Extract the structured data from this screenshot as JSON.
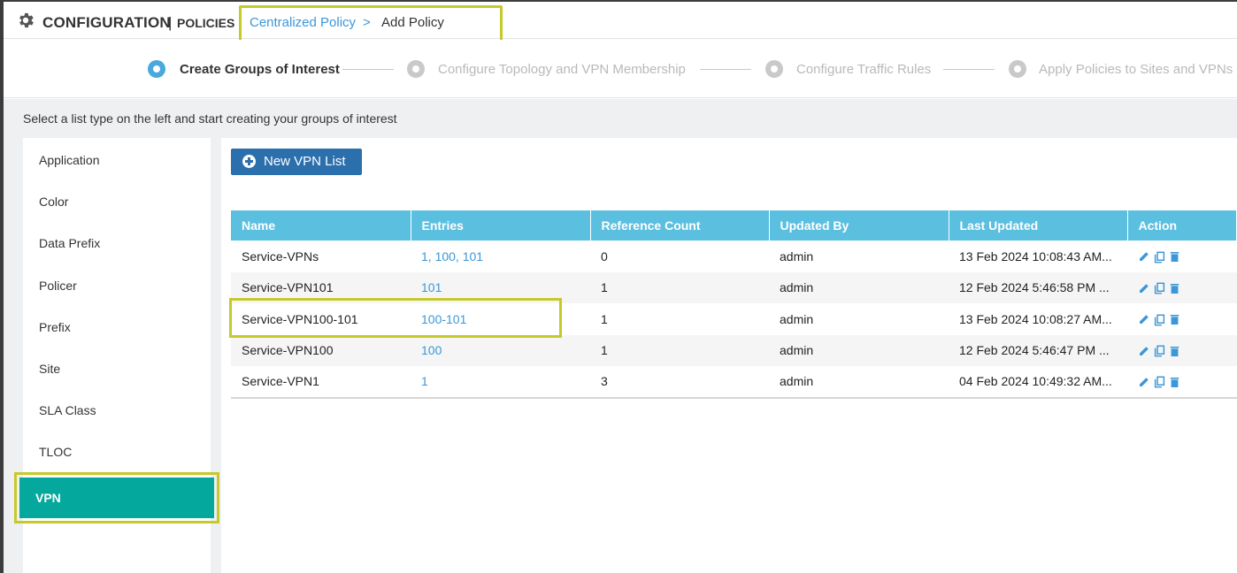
{
  "header": {
    "title": "CONFIGURATION",
    "separator": "|",
    "subtitle": "POLICIES",
    "breadcrumb_link": "Centralized Policy",
    "breadcrumb_arrow": ">",
    "breadcrumb_current": "Add Policy"
  },
  "steps": [
    {
      "label": "Create Groups of Interest",
      "state": "active"
    },
    {
      "label": "Configure Topology and VPN Membership",
      "state": "inactive"
    },
    {
      "label": "Configure Traffic Rules",
      "state": "inactive"
    },
    {
      "label": "Apply Policies to Sites and VPNs",
      "state": "inactive"
    }
  ],
  "instructions": "Select a list type on the left and start creating your groups of interest",
  "sidebar": {
    "items": [
      "Application",
      "Color",
      "Data Prefix",
      "Policer",
      "Prefix",
      "Site",
      "SLA Class",
      "TLOC"
    ],
    "active": "VPN"
  },
  "main": {
    "new_button": "New VPN List",
    "table": {
      "headers": [
        "Name",
        "Entries",
        "Reference Count",
        "Updated By",
        "Last Updated",
        "Action"
      ],
      "rows": [
        {
          "name": "Service-VPNs",
          "entries": "1, 100, 101",
          "ref": "0",
          "by": "admin",
          "updated": "13 Feb 2024 10:08:43 AM..."
        },
        {
          "name": "Service-VPN101",
          "entries": "101",
          "ref": "1",
          "by": "admin",
          "updated": "12 Feb 2024 5:46:58 PM ..."
        },
        {
          "name": "Service-VPN100-101",
          "entries": "100-101",
          "ref": "1",
          "by": "admin",
          "updated": "13 Feb 2024 10:08:27 AM..."
        },
        {
          "name": "Service-VPN100",
          "entries": "100",
          "ref": "1",
          "by": "admin",
          "updated": "12 Feb 2024 5:46:47 PM ..."
        },
        {
          "name": "Service-VPN1",
          "entries": "1",
          "ref": "3",
          "by": "admin",
          "updated": "04 Feb 2024 10:49:32 AM..."
        }
      ]
    }
  },
  "icons": {
    "settings": "gear-icon",
    "edit": "pencil-icon",
    "copy": "copy-icon",
    "delete": "trash-icon"
  },
  "colors": {
    "accent": "#49a8dc",
    "table_header": "#5bbfe0",
    "active_item": "#04a89d",
    "button": "#2c6fad",
    "highlight_box": "#c6c92a",
    "link": "#3b97d8"
  }
}
